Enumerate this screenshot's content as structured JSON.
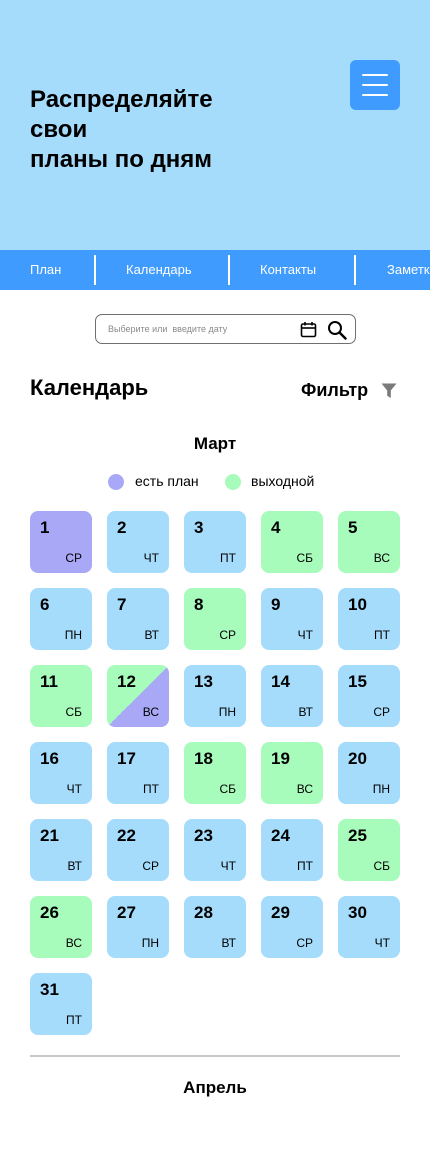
{
  "hero": {
    "title_lines": [
      "Распределяйте",
      "свои",
      "планы по дням"
    ],
    "menu_icon": "hamburger-menu-icon"
  },
  "nav": {
    "items": [
      "План",
      "Календарь",
      "Контакты",
      "Заметки"
    ]
  },
  "search": {
    "placeholder": "Выберите или  введите дату",
    "calendar_icon": "calendar-icon",
    "search_icon": "search-icon"
  },
  "calendar": {
    "title": "Календарь",
    "filter_label": "Фильтр",
    "filter_icon": "filter-icon",
    "month": "Март",
    "next_month": "Апрель",
    "legend": [
      {
        "label": "есть план",
        "color": "#a9a8f7"
      },
      {
        "label": "выходной",
        "color": "#a7fbbb"
      }
    ],
    "days": [
      {
        "num": "1",
        "wd": "СР",
        "type": "plan"
      },
      {
        "num": "2",
        "wd": "ЧТ",
        "type": "normal"
      },
      {
        "num": "3",
        "wd": "ПТ",
        "type": "normal"
      },
      {
        "num": "4",
        "wd": "СБ",
        "type": "off"
      },
      {
        "num": "5",
        "wd": "ВС",
        "type": "off"
      },
      {
        "num": "6",
        "wd": "ПН",
        "type": "normal"
      },
      {
        "num": "7",
        "wd": "ВТ",
        "type": "normal"
      },
      {
        "num": "8",
        "wd": "СР",
        "type": "off"
      },
      {
        "num": "9",
        "wd": "ЧТ",
        "type": "normal"
      },
      {
        "num": "10",
        "wd": "ПТ",
        "type": "normal"
      },
      {
        "num": "11",
        "wd": "СБ",
        "type": "off"
      },
      {
        "num": "12",
        "wd": "ВС",
        "type": "split"
      },
      {
        "num": "13",
        "wd": "ПН",
        "type": "normal"
      },
      {
        "num": "14",
        "wd": "ВТ",
        "type": "normal"
      },
      {
        "num": "15",
        "wd": "СР",
        "type": "normal"
      },
      {
        "num": "16",
        "wd": "ЧТ",
        "type": "normal"
      },
      {
        "num": "17",
        "wd": "ПТ",
        "type": "normal"
      },
      {
        "num": "18",
        "wd": "СБ",
        "type": "off"
      },
      {
        "num": "19",
        "wd": "ВС",
        "type": "off"
      },
      {
        "num": "20",
        "wd": "ПН",
        "type": "normal"
      },
      {
        "num": "21",
        "wd": "ВТ",
        "type": "normal"
      },
      {
        "num": "22",
        "wd": "СР",
        "type": "normal"
      },
      {
        "num": "23",
        "wd": "ЧТ",
        "type": "normal"
      },
      {
        "num": "24",
        "wd": "ПТ",
        "type": "normal"
      },
      {
        "num": "25",
        "wd": "СБ",
        "type": "off"
      },
      {
        "num": "26",
        "wd": "ВС",
        "type": "off"
      },
      {
        "num": "27",
        "wd": "ПН",
        "type": "normal"
      },
      {
        "num": "28",
        "wd": "ВТ",
        "type": "normal"
      },
      {
        "num": "29",
        "wd": "СР",
        "type": "normal"
      },
      {
        "num": "30",
        "wd": "ЧТ",
        "type": "normal"
      },
      {
        "num": "31",
        "wd": "ПТ",
        "type": "normal"
      }
    ]
  },
  "colors": {
    "hero_bg": "#a5dcfb",
    "accent": "#3f9bfd",
    "day_normal": "#a5dcfb",
    "day_plan": "#a9a8f7",
    "day_off": "#a7fbbb"
  }
}
